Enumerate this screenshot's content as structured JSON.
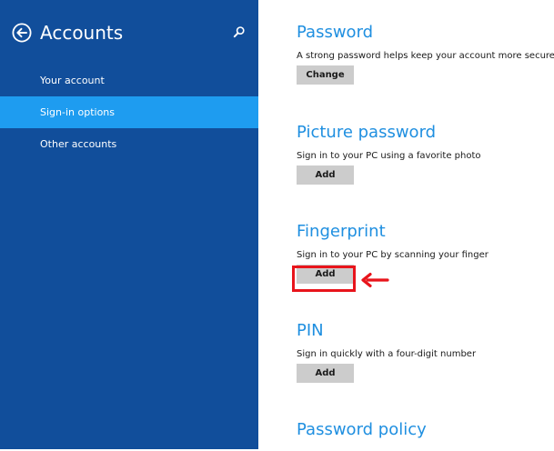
{
  "sidebar": {
    "title": "Accounts",
    "back_icon": "back-arrow-circle-icon",
    "search_icon": "search-icon",
    "items": [
      {
        "label": "Your account",
        "active": false
      },
      {
        "label": "Sign-in options",
        "active": true
      },
      {
        "label": "Other accounts",
        "active": false
      }
    ]
  },
  "sections": {
    "password": {
      "title": "Password",
      "description": "A strong password helps keep your account more secure",
      "button_label": "Change"
    },
    "picture_password": {
      "title": "Picture password",
      "description": "Sign in to your PC using a favorite photo",
      "button_label": "Add"
    },
    "fingerprint": {
      "title": "Fingerprint",
      "description": "Sign in to your PC by scanning your finger",
      "button_label": "Add"
    },
    "pin": {
      "title": "PIN",
      "description": "Sign in quickly with a four-digit number",
      "button_label": "Add"
    },
    "password_policy": {
      "title": "Password policy"
    }
  },
  "annotation": {
    "highlight_target": "fingerprint add button",
    "arrow_icon": "red-arrow-icon"
  },
  "colors": {
    "sidebar_bg": "#114e9b",
    "active_item_bg": "#1e9cf0",
    "section_title": "#1f8fe0",
    "button_bg": "#cccccc",
    "annotation_red": "#e8141b"
  }
}
